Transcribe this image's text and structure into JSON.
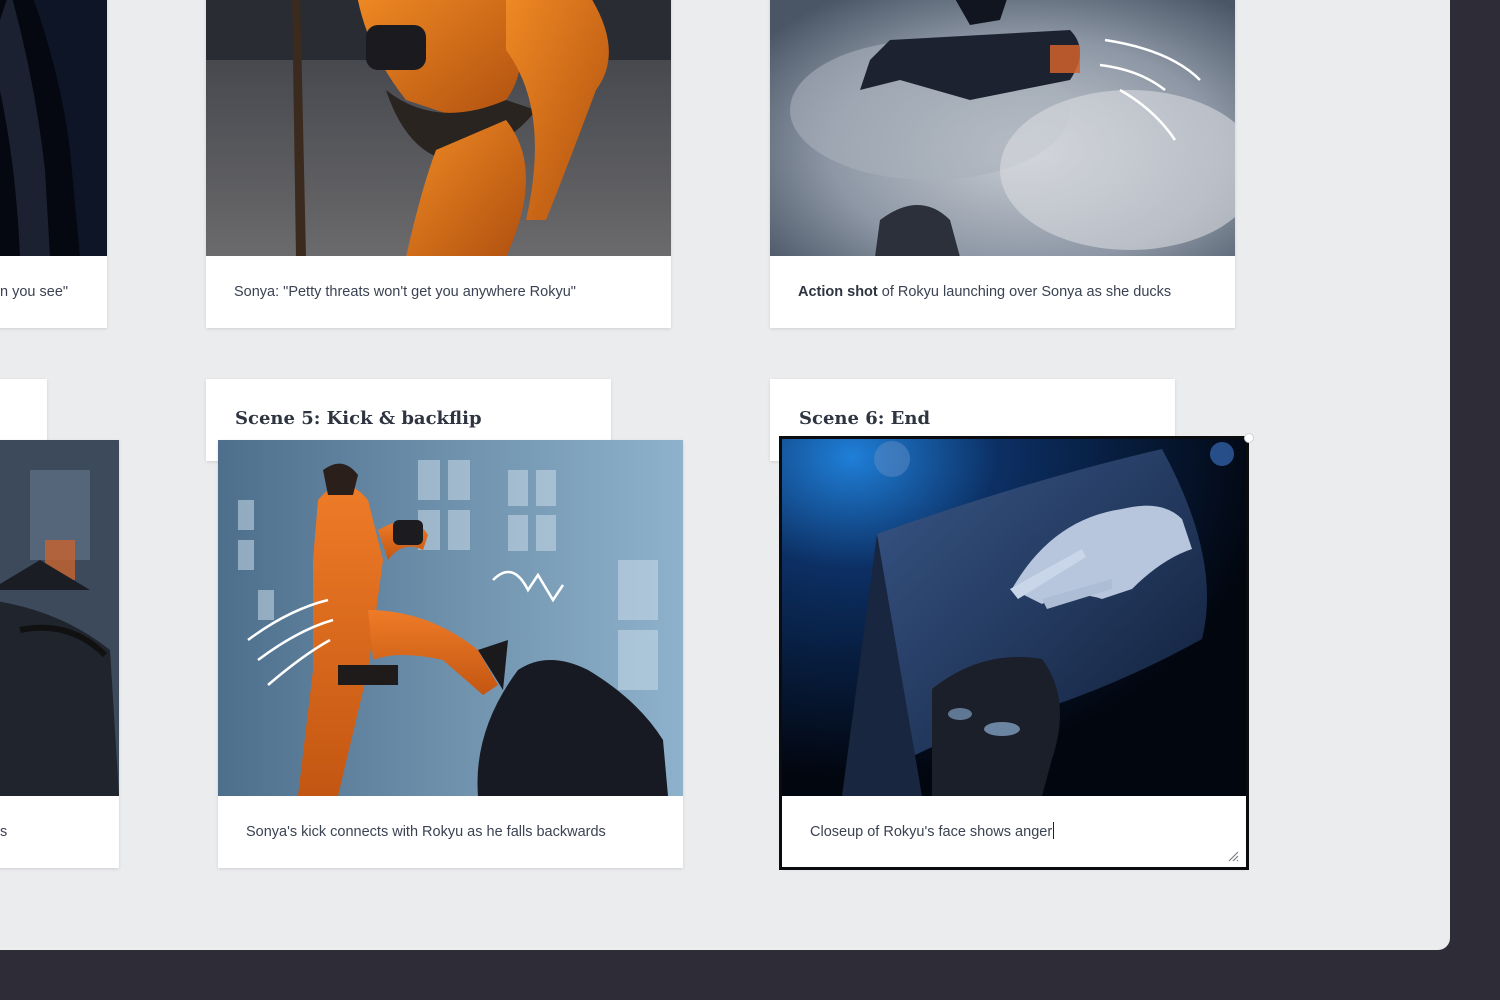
{
  "colors": {
    "app_frame": "#2e2c37",
    "canvas": "#ebecee",
    "card": "#ffffff",
    "selection": "#0b0c10"
  },
  "board": {
    "top_row": [
      {
        "caption": "n you see\""
      },
      {
        "caption": "Sonya: \"Petty threats won't get you anywhere Rokyu\""
      },
      {
        "caption_bold": "Action shot",
        "caption_rest": " of Rokyu launching over Sonya as she ducks"
      }
    ],
    "bottom_row": [
      {
        "title": "",
        "caption": "s"
      },
      {
        "title": "Scene 5: Kick & backflip",
        "caption": "Sonya's kick connects with Rokyu as he falls backwards"
      },
      {
        "title": "Scene 6: End",
        "caption": "Closeup of Rokyu's face shows anger"
      }
    ]
  }
}
